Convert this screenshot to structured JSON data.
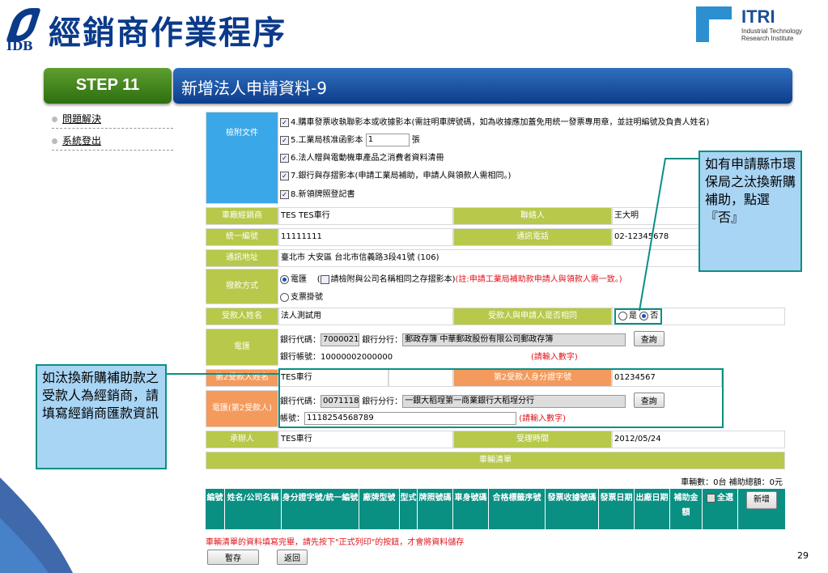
{
  "header": {
    "idb_logo_text": "IDB",
    "title": "經銷商作業程序",
    "itri": {
      "name": "ITRI",
      "sub": "Industrial Technology Research Institute"
    }
  },
  "step": {
    "label": "STEP 11",
    "title": "新增法人申請資料-9"
  },
  "sidebar": {
    "items": [
      {
        "label": "問題解決"
      },
      {
        "label": "系統登出"
      }
    ]
  },
  "attachments": {
    "label": "檢附文件",
    "items": [
      {
        "text": "4.購車發票收執聯影本或收據影本(需註明車牌號碼，如為收據應加蓋免用統一發票專用章，並註明編號及負責人姓名)",
        "checked": true
      },
      {
        "text": "5.工業局核准函影本",
        "checked": true,
        "qty": "1",
        "unit": "張"
      },
      {
        "text": "6.法人贈與電動機車產品之消費者資料清冊",
        "checked": true
      },
      {
        "text": "7.銀行與存摺影本(申請工業局補助，申請人與領款人需相同。)",
        "checked": true
      },
      {
        "text": "8.新領牌照登記書",
        "checked": true
      }
    ]
  },
  "form": {
    "dealer_label": "車廠經銷商",
    "dealer_value": "TES TES車行",
    "contact_label": "聯絡人",
    "contact_value": "王大明",
    "taxid_label": "統一編號",
    "taxid_value": "11111111",
    "phone_label": "通訊電話",
    "phone_value": "02-12345678",
    "address_label": "通訊地址",
    "address_value": "臺北市 大安區 台北市信義路3段41號 (106)",
    "payment_label": "撥款方式",
    "payment_wire": "電匯",
    "payment_wire_note_open": "(",
    "payment_wire_check": "請檢附與公司名稱相同之存摺影本)",
    "payment_wire_red": "(註:申請工業局補助款申請人與領款人需一致。)",
    "payment_check": "支票掛號",
    "payee_label": "受款人姓名",
    "payee_value": "法人測試用",
    "same_label": "受款人與申請人是否相同",
    "same_yes": "是",
    "same_no": "否",
    "wire_label": "電匯",
    "bank_code_label": "銀行代碼：",
    "bank_code": "7000021",
    "branch_label": "銀行分行：",
    "branch_value": "郵政存簿 中華郵政股份有限公司郵政存簿",
    "query_btn": "查詢",
    "account_label": "銀行帳號：",
    "account_value": "10000002000000",
    "digits_note": "(請輸入數字)",
    "payee2_label": "第2受款人姓名",
    "payee2_value": "TES車行",
    "id2_label": "第2受款人身分證字號",
    "id2_value": "01234567",
    "wire2_label": "電匯(第2受款人)",
    "bank_code2": "0071118",
    "branch2_value": "一銀大稻埕第一商業銀行大稻埕分行",
    "account2_label": "帳號：",
    "account2_value": "1118254568789",
    "handler_label": "承辦人",
    "handler_value": "TES車行",
    "accept_label": "受理時間",
    "accept_value": "2012/05/24",
    "vehicle_list_label": "車輛清單"
  },
  "summary": "車輛數：0台  補助總額：0元",
  "table_headers": [
    "編號",
    "姓名/公司名稱",
    "身分證字號/統一編號",
    "廠牌型號",
    "型式",
    "牌照號碼",
    "車身號碼",
    "合格標籤序號",
    "發票收據號碼",
    "發票日期",
    "出廠日期",
    "補助金額",
    "全選"
  ],
  "add_btn": "新增",
  "footer_note": "車輛清單的資料填寫完畢，請先按下\"正式列印\"的按鈕，才會將資料儲存",
  "buttons": {
    "save": "暫存",
    "back": "返回"
  },
  "callouts": {
    "right": "如有申請縣市環保局之汰換新購補助，點選『否』",
    "left": "如汰換新購補助款之受款人為經銷商，請填寫經銷商匯款資訊"
  },
  "page_number": "29",
  "colors": {
    "title_blue": "#0b3a8a",
    "step_green": "#3d8a1e",
    "label_blue": "#3aa8e8",
    "label_olive": "#b7c84a",
    "label_orange": "#f39a5c",
    "teal": "#0a8f83",
    "callout_bg": "#a9d5f5"
  }
}
